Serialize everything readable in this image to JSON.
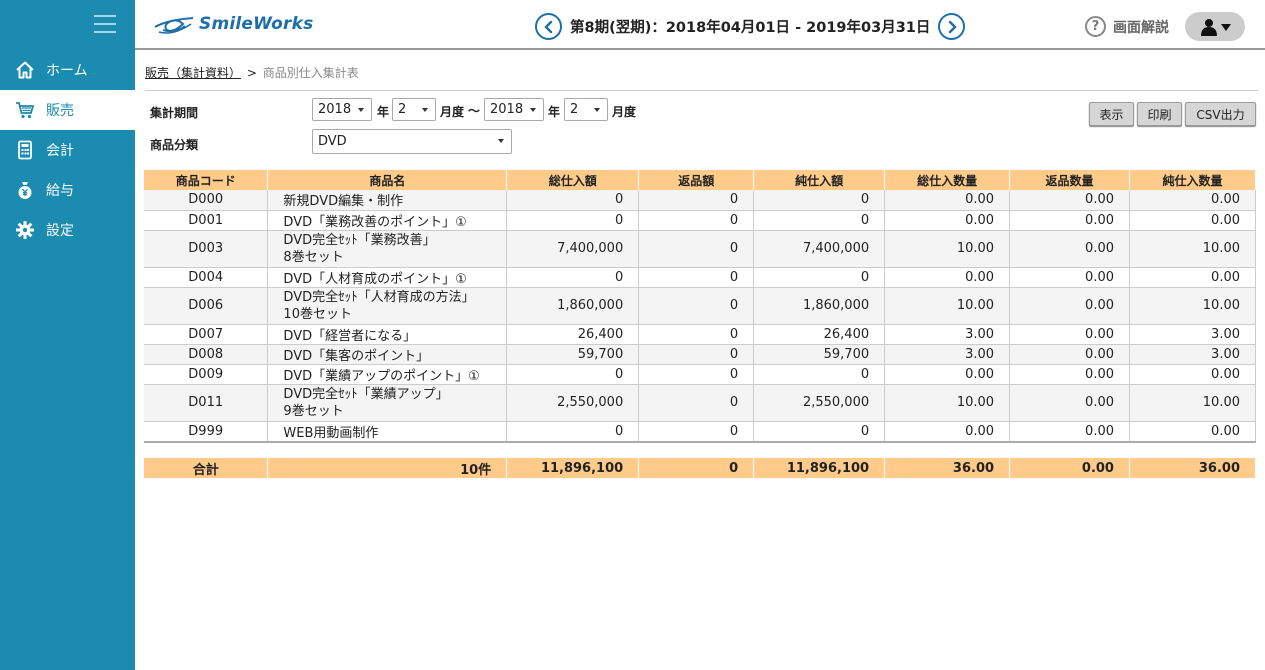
{
  "sidebar": {
    "items": [
      {
        "label": "ホーム",
        "icon": "home-icon"
      },
      {
        "label": "販売",
        "icon": "cart-icon"
      },
      {
        "label": "会計",
        "icon": "calculator-icon"
      },
      {
        "label": "給与",
        "icon": "money-bag-icon"
      },
      {
        "label": "設定",
        "icon": "gear-icon"
      }
    ],
    "active": "販売"
  },
  "header": {
    "logo_text": "SmileWorks",
    "period": "第8期(翌期)：2018年04月01日 - 2019年03月31日",
    "help_label": "画面解説"
  },
  "breadcrumb": {
    "parent": "販売（集計資料）",
    "separator": ">",
    "current": "商品別仕入集計表"
  },
  "form": {
    "period_label": "集計期間",
    "from_year": "2018",
    "from_month": "2",
    "to_year": "2018",
    "to_month": "2",
    "year_unit": "年",
    "month_unit": "月度",
    "range_sep": "〜",
    "category_label": "商品分類",
    "category_value": "DVD"
  },
  "buttons": {
    "show": "表示",
    "print": "印刷",
    "csv": "CSV出力"
  },
  "table": {
    "headers": [
      "商品コード",
      "商品名",
      "総仕入額",
      "返品額",
      "純仕入額",
      "総仕入数量",
      "返品数量",
      "純仕入数量"
    ],
    "rows": [
      [
        "D000",
        "新規DVD編集・制作",
        "0",
        "0",
        "0",
        "0.00",
        "0.00",
        "0.00"
      ],
      [
        "D001",
        "DVD「業務改善のポイント」①",
        "0",
        "0",
        "0",
        "0.00",
        "0.00",
        "0.00"
      ],
      [
        "D003",
        "DVD完全ｾｯﾄ「業務改善」\n8巻セット",
        "7,400,000",
        "0",
        "7,400,000",
        "10.00",
        "0.00",
        "10.00"
      ],
      [
        "D004",
        "DVD「人材育成のポイント」①",
        "0",
        "0",
        "0",
        "0.00",
        "0.00",
        "0.00"
      ],
      [
        "D006",
        "DVD完全ｾｯﾄ「人材育成の方法」\n10巻セット",
        "1,860,000",
        "0",
        "1,860,000",
        "10.00",
        "0.00",
        "10.00"
      ],
      [
        "D007",
        "DVD「経営者になる」",
        "26,400",
        "0",
        "26,400",
        "3.00",
        "0.00",
        "3.00"
      ],
      [
        "D008",
        "DVD「集客のポイント」",
        "59,700",
        "0",
        "59,700",
        "3.00",
        "0.00",
        "3.00"
      ],
      [
        "D009",
        "DVD「業績アップのポイント」①",
        "0",
        "0",
        "0",
        "0.00",
        "0.00",
        "0.00"
      ],
      [
        "D011",
        "DVD完全ｾｯﾄ「業績アップ」\n9巻セット",
        "2,550,000",
        "0",
        "2,550,000",
        "10.00",
        "0.00",
        "10.00"
      ],
      [
        "D999",
        "WEB用動画制作",
        "0",
        "0",
        "0",
        "0.00",
        "0.00",
        "0.00"
      ]
    ],
    "total": [
      "合計",
      "10件",
      "11,896,100",
      "0",
      "11,896,100",
      "36.00",
      "0.00",
      "36.00"
    ]
  },
  "colors": {
    "sidebar_bg": "#1b8bb0",
    "header_row": "#ffcb8b",
    "accent": "#1c6fa8"
  }
}
